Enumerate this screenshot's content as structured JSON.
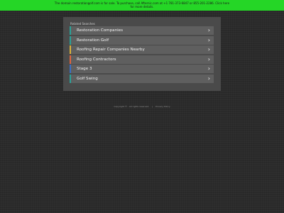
{
  "banner": {
    "line1": "The domain restorationgolf.com is for sale. To purchase, call Afternic.com at +1 781-373-6847 or 855-201-2286. Click here",
    "line2": "for more details."
  },
  "panel": {
    "header": "Related Searches",
    "items": [
      {
        "label": "Restoration Companies",
        "accent": "#2aa198"
      },
      {
        "label": "Restoration Golf",
        "accent": "#2aa198"
      },
      {
        "label": "Roofing Repair Companies Nearby",
        "accent": "#d8b13a"
      },
      {
        "label": "Roofing Contractors",
        "accent": "#e0633f"
      },
      {
        "label": "Stage 3",
        "accent": "#3a6fc4"
      },
      {
        "label": "Golf Swing",
        "accent": "#2aa198"
      }
    ]
  },
  "footer": {
    "copyright": "Copyright © . All rights reserved.",
    "separator": "|",
    "privacy": "Privacy Policy"
  },
  "colors": {
    "banner_bg": "#25d626",
    "page_bg": "#2b2b2b",
    "panel_bg": "#4a4a4a",
    "item_bg": "#5f5f5f"
  },
  "icons": {
    "item_chevron": "chevron-right-icon"
  }
}
